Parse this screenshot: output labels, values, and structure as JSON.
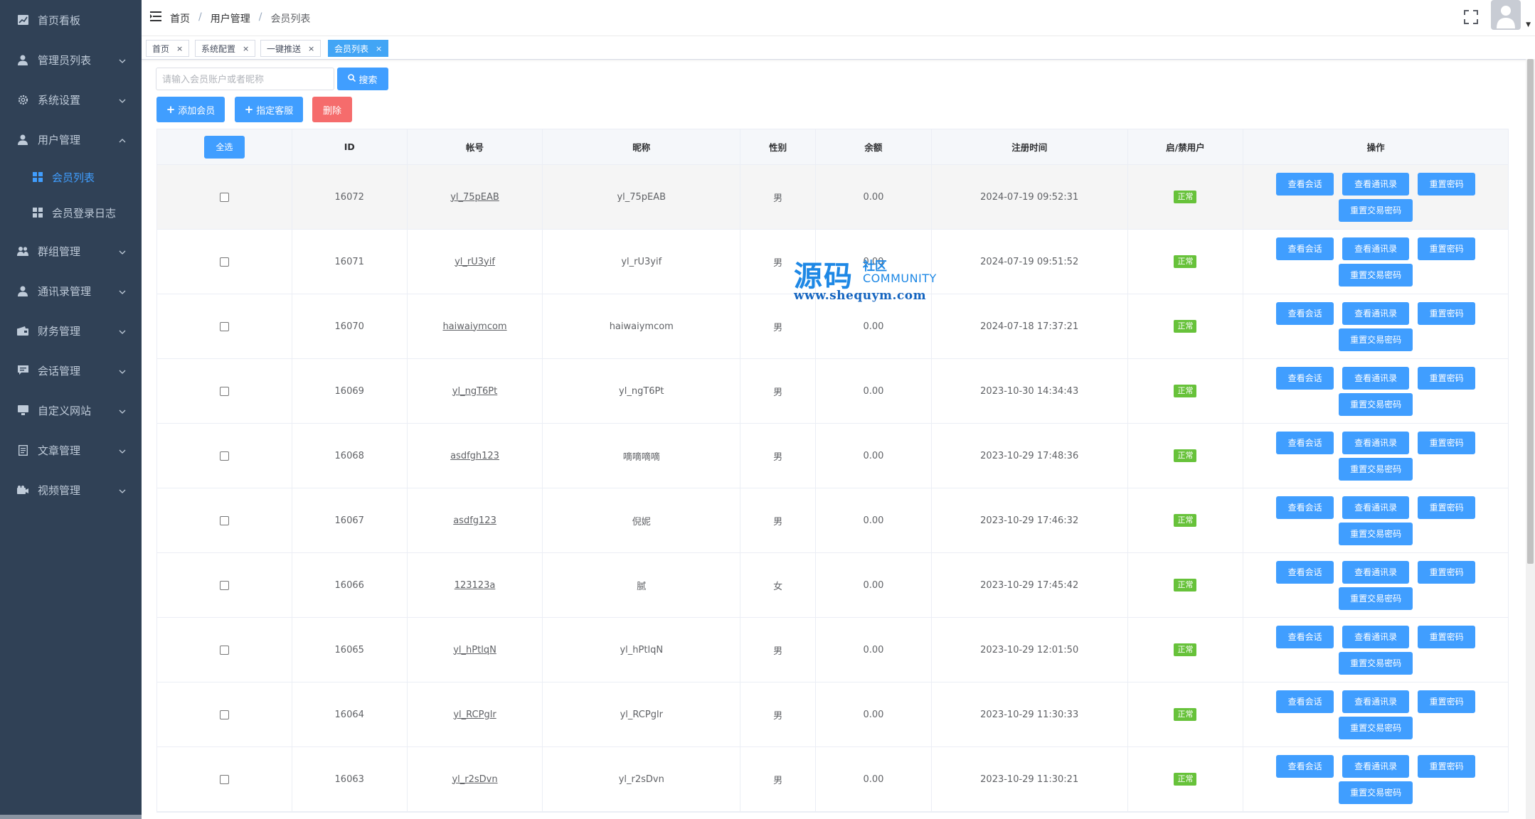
{
  "sidebar": {
    "items": [
      {
        "label": "首页看板",
        "icon": "chart-icon",
        "has_arrow": false
      },
      {
        "label": "管理员列表",
        "icon": "user-icon",
        "has_arrow": true
      },
      {
        "label": "系统设置",
        "icon": "gear-icon",
        "has_arrow": true
      },
      {
        "label": "用户管理",
        "icon": "user-icon",
        "has_arrow": true
      },
      {
        "label": "会员列表",
        "icon": "grid-icon",
        "has_arrow": false
      },
      {
        "label": "会员登录日志",
        "icon": "grid-icon",
        "has_arrow": false
      },
      {
        "label": "群组管理",
        "icon": "group-icon",
        "has_arrow": true
      },
      {
        "label": "通讯录管理",
        "icon": "user-icon",
        "has_arrow": true
      },
      {
        "label": "财务管理",
        "icon": "wallet-icon",
        "has_arrow": true
      },
      {
        "label": "会话管理",
        "icon": "chat-icon",
        "has_arrow": true
      },
      {
        "label": "自定义网站",
        "icon": "monitor-icon",
        "has_arrow": true
      },
      {
        "label": "文章管理",
        "icon": "document-icon",
        "has_arrow": true
      },
      {
        "label": "视频管理",
        "icon": "camera-icon",
        "has_arrow": true
      }
    ]
  },
  "header": {
    "breadcrumb": [
      "首页",
      "用户管理",
      "会员列表"
    ]
  },
  "tags": [
    {
      "label": "首页"
    },
    {
      "label": "系统配置"
    },
    {
      "label": "一键推送"
    },
    {
      "label": "会员列表",
      "active": true
    }
  ],
  "toolbar": {
    "search_placeholder": "请输入会员账户或者昵称",
    "search_label": "搜索",
    "add_label": "添加会员",
    "assign_label": "指定客服",
    "delete_label": "删除"
  },
  "table": {
    "select_all": "全选",
    "columns": [
      "ID",
      "帐号",
      "昵称",
      "性别",
      "余额",
      "注册时间",
      "启/禁用户",
      "操作"
    ],
    "actions": [
      "查看会话",
      "查看通讯录",
      "重置密码",
      "重置交易密码"
    ],
    "rows": [
      {
        "id": "16072",
        "account": "yl_75pEAB",
        "nickname": "yl_75pEAB",
        "gender": "男",
        "balance": "0.00",
        "time": "2024-07-19 09:52:31",
        "status": "正常"
      },
      {
        "id": "16071",
        "account": "yl_rU3yif",
        "nickname": "yl_rU3yif",
        "gender": "男",
        "balance": "0.00",
        "time": "2024-07-19 09:51:52",
        "status": "正常"
      },
      {
        "id": "16070",
        "account": "haiwaiymcom",
        "nickname": "haiwaiymcom",
        "gender": "男",
        "balance": "0.00",
        "time": "2024-07-18 17:37:21",
        "status": "正常"
      },
      {
        "id": "16069",
        "account": "yl_ngT6Pt",
        "nickname": "yl_ngT6Pt",
        "gender": "男",
        "balance": "0.00",
        "time": "2023-10-30 14:34:43",
        "status": "正常"
      },
      {
        "id": "16068",
        "account": "asdfgh123",
        "nickname": "嘀嘀嘀嘀",
        "gender": "男",
        "balance": "0.00",
        "time": "2023-10-29 17:48:36",
        "status": "正常"
      },
      {
        "id": "16067",
        "account": "asdfg123",
        "nickname": "倪妮",
        "gender": "男",
        "balance": "0.00",
        "time": "2023-10-29 17:46:32",
        "status": "正常"
      },
      {
        "id": "16066",
        "account": "123123a",
        "nickname": "腻",
        "gender": "女",
        "balance": "0.00",
        "time": "2023-10-29 17:45:42",
        "status": "正常"
      },
      {
        "id": "16065",
        "account": "yl_hPtlqN",
        "nickname": "yl_hPtlqN",
        "gender": "男",
        "balance": "0.00",
        "time": "2023-10-29 12:01:50",
        "status": "正常"
      },
      {
        "id": "16064",
        "account": "yl_RCPglr",
        "nickname": "yl_RCPglr",
        "gender": "男",
        "balance": "0.00",
        "time": "2023-10-29 11:30:33",
        "status": "正常"
      },
      {
        "id": "16063",
        "account": "yl_r2sDvn",
        "nickname": "yl_r2sDvn",
        "gender": "男",
        "balance": "0.00",
        "time": "2023-10-29 11:30:21",
        "status": "正常"
      }
    ]
  },
  "watermark": {
    "big": "源码",
    "small": "社区",
    "community": "COMMUNITY",
    "url": "www.shequym.com"
  }
}
